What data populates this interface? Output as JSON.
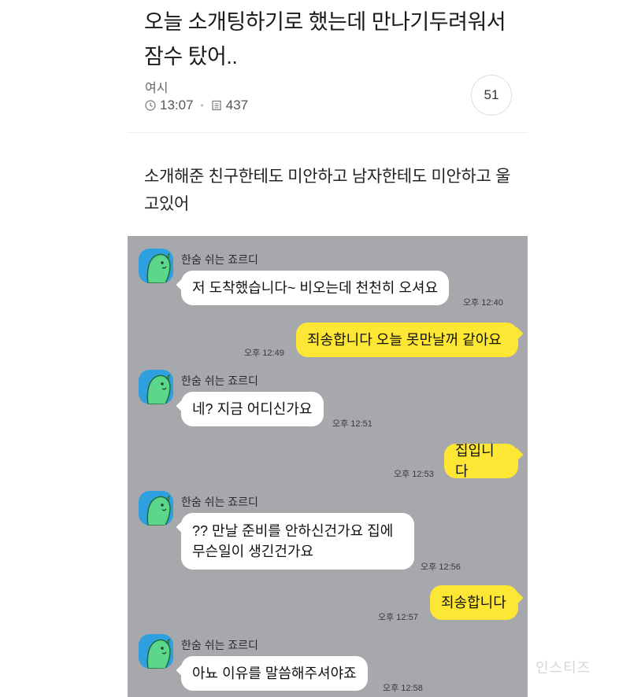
{
  "post": {
    "title": "오늘 소개팅하기로 했는데 만나기두려워서 잠수 탔어..",
    "author": "여시",
    "time": "13:07",
    "views": "437",
    "comment_count": "51",
    "body": "소개해준 친구한테도 미안하고 남자한테도 미안하고 울고있어"
  },
  "chat": {
    "sender_name": "한숨 쉬는 죠르디",
    "messages": [
      {
        "side": "in",
        "text": "저 도착했습니다~ 비오는데 천천히 오셔요",
        "time": "오후 12:40"
      },
      {
        "side": "out",
        "text": "죄송합니다 오늘 못만날꺼 같아요",
        "time": "오후 12:49"
      },
      {
        "side": "in",
        "text": "네? 지금 어디신가요",
        "time": "오후 12:51"
      },
      {
        "side": "out",
        "text": "집입니다",
        "time": "오후 12:53"
      },
      {
        "side": "in",
        "text": "?? 만날 준비를 안하신건가요 집에",
        "text2": "무슨일이 생긴건가요",
        "time": "오후 12:56"
      },
      {
        "side": "out",
        "text": "죄송합니다",
        "time": "오후 12:57"
      },
      {
        "side": "in",
        "text": "아뇨 이유를 말씀해주셔야죠",
        "time": "오후 12:58"
      }
    ]
  },
  "watermark": "인스티즈",
  "colors": {
    "chat_bg": "#a7a8ab",
    "my_bubble": "#fde634",
    "their_bubble": "#ffffff",
    "avatar_bg": "#2ea0df",
    "character": "#5cd68a"
  }
}
